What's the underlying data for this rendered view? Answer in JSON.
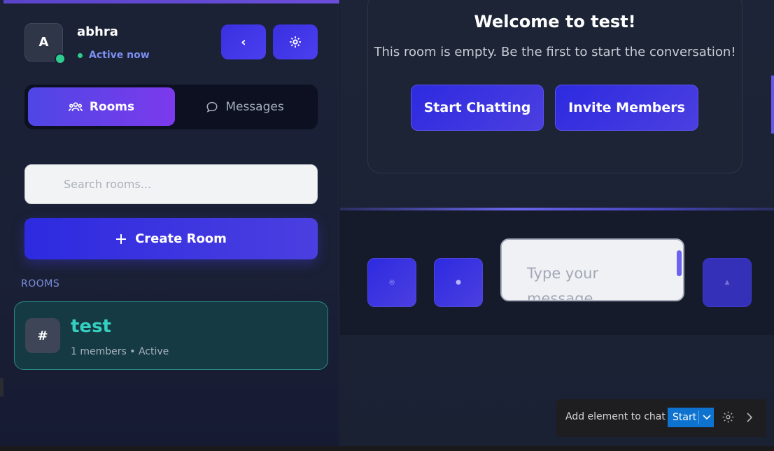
{
  "user": {
    "avatar_letter": "A",
    "name": "abhra",
    "status": "Active now"
  },
  "header_buttons": {
    "collapse_glyph": "‹"
  },
  "tabs": [
    {
      "label": "Rooms",
      "active": true
    },
    {
      "label": "Messages",
      "active": false
    }
  ],
  "search": {
    "placeholder": "Search rooms..."
  },
  "create_room": {
    "label": "Create Room"
  },
  "rooms_section": {
    "heading": "ROOMS",
    "items": [
      {
        "icon": "#",
        "name": "test",
        "meta": "1 members • Active"
      }
    ]
  },
  "welcome": {
    "title": "Welcome to test!",
    "subtitle": "This room is empty. Be the first to start the conversation!",
    "buttons": {
      "start": "Start Chatting",
      "invite": "Invite Members"
    }
  },
  "composer": {
    "placeholder": "Type your message..."
  },
  "floating_toolbar": {
    "label": "Add element to chat",
    "start": "Start"
  },
  "colors": {
    "accent": "#4f46e5",
    "online": "#2ecc8f",
    "room_accent": "#35d1c0",
    "vscode_blue": "#0e73d0"
  },
  "icons": [
    "users-icon",
    "chat-bubble-icon",
    "gear-icon",
    "plus-icon",
    "chevron-left-icon",
    "chevron-down-icon",
    "chevron-right-icon"
  ]
}
